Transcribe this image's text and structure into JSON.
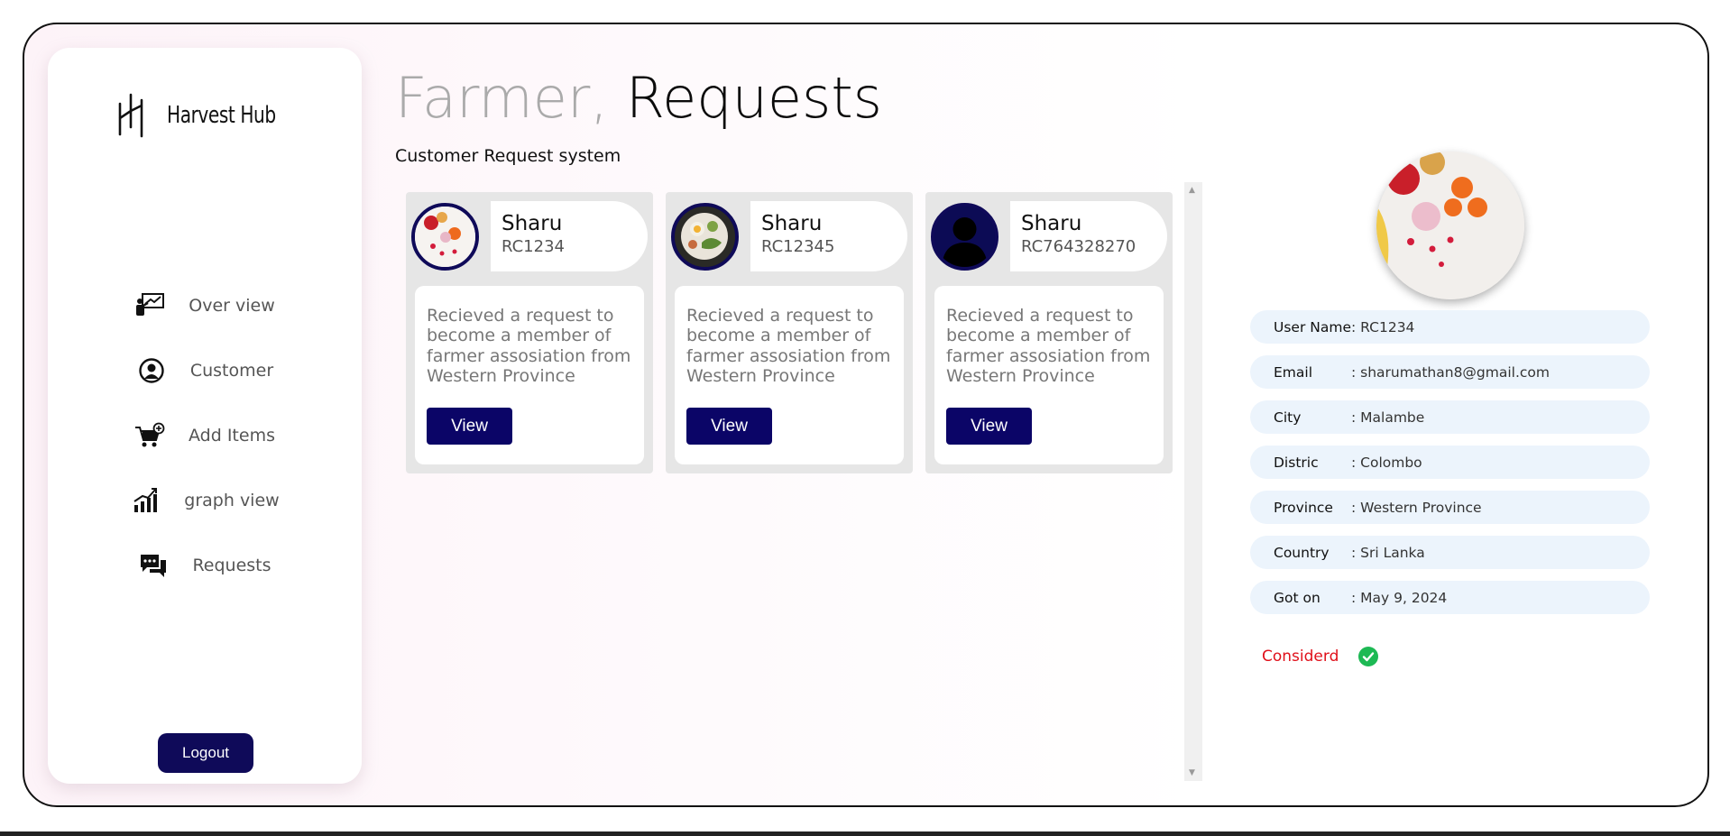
{
  "brand": {
    "name": "Harvest Hub",
    "logo_icon": "hh-logo-icon"
  },
  "sidebar": {
    "items": [
      {
        "label": "Over view",
        "icon": "presentation-chart-icon"
      },
      {
        "label": "Customer",
        "icon": "user-circle-icon"
      },
      {
        "label": "Add Items",
        "icon": "cart-plus-icon"
      },
      {
        "label": "graph view",
        "icon": "bar-graph-icon"
      },
      {
        "label": "Requests",
        "icon": "chat-bubbles-icon"
      }
    ],
    "logout_label": "Logout"
  },
  "header": {
    "title_prefix": "Farmer,",
    "title_main": "Requests",
    "subtitle": "Customer Request system"
  },
  "requests": [
    {
      "name": "Sharu",
      "code": "RC1234",
      "avatar": "fruit-photo",
      "message": "Recieved a request to become a member of farmer assosiation from Western Province",
      "button": "View"
    },
    {
      "name": "Sharu",
      "code": "RC12345",
      "avatar": "salad-photo",
      "message": "Recieved a request to become a member of farmer assosiation from Western Province",
      "button": "View"
    },
    {
      "name": "Sharu",
      "code": "RC764328270",
      "avatar": "default-user-silhouette",
      "message": "Recieved a request to become a member of farmer assosiation from Western Province",
      "button": "View"
    }
  ],
  "details": {
    "rows": [
      {
        "key": "User Name",
        "value": ": RC1234"
      },
      {
        "key": "Email",
        "value": ": sharumathan8@gmail.com"
      },
      {
        "key": "City",
        "value": ": Malambe"
      },
      {
        "key": "Distric",
        "value": ": Colombo"
      },
      {
        "key": "Province",
        "value": ": Western Province"
      },
      {
        "key": "Country",
        "value": ": Sri Lanka"
      },
      {
        "key": "Got on",
        "value": ": May 9, 2024"
      }
    ],
    "status": "Considerd",
    "status_icon": "green-check-circle-icon"
  },
  "colors": {
    "primary": "#0f0a59",
    "status_text": "#e0101a",
    "status_icon": "#1db954",
    "detail_row_bg": "#ecf4fc"
  }
}
